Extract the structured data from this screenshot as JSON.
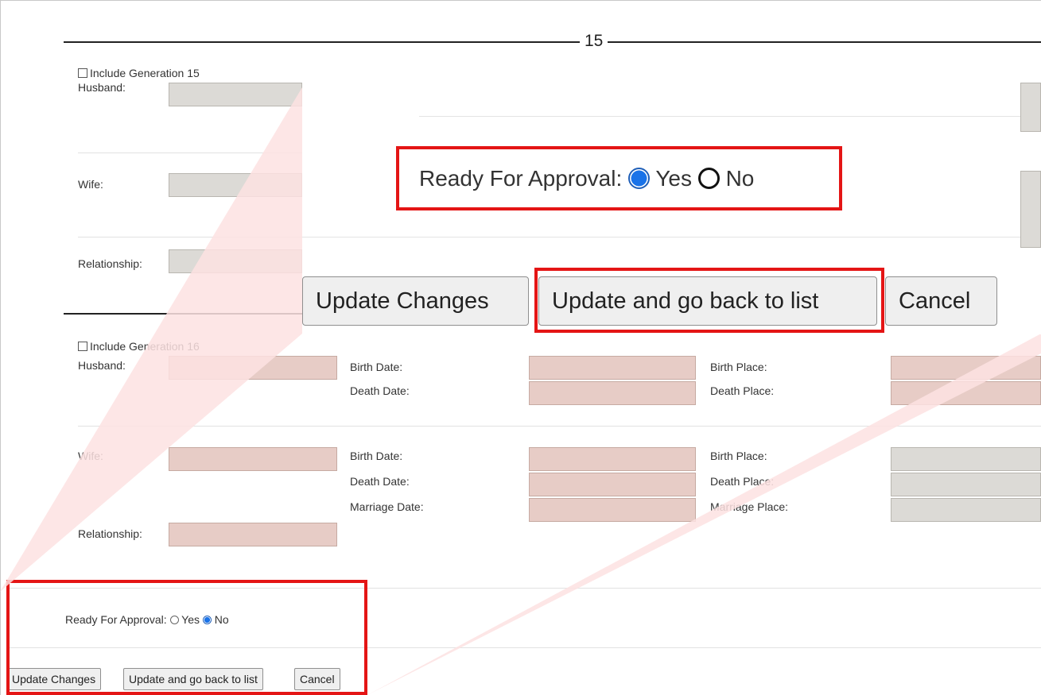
{
  "generation15": {
    "number": "15",
    "include_label": "Include Generation 15",
    "husband_label": "Husband:",
    "wife_label": "Wife:",
    "relationship_label": "Relationship:"
  },
  "generation16": {
    "include_label": "Include Generation 16",
    "husband_label": "Husband:",
    "birth_date_label": "Birth Date:",
    "death_date_label": "Death Date:",
    "birth_place_label": "Birth Place:",
    "death_place_label": "Death Place:",
    "wife_label": "Wife:",
    "wife_birth_date_label": "Birth Date:",
    "wife_death_date_label": "Death Date:",
    "marriage_date_label": "Marriage Date:",
    "wife_birth_place_label": "Birth Place:",
    "wife_death_place_label": "Death Place:",
    "marriage_place_label": "Marriage Place:",
    "relationship_label": "Relationship:"
  },
  "approval": {
    "label": "Ready For Approval:",
    "yes_label": "Yes",
    "no_label": "No",
    "selected": "No"
  },
  "zoom": {
    "approval_label": "Ready For Approval:",
    "yes_label": "Yes",
    "no_label": "No",
    "selected": "Yes",
    "update_changes_label": "Update Changes",
    "update_back_label": "Update and go back to list",
    "cancel_label": "Cancel"
  },
  "buttons": {
    "update_changes_label": "Update Changes",
    "update_back_label": "Update and go back to list",
    "cancel_label": "Cancel"
  },
  "colors": {
    "highlight_box": "#e41515",
    "zoom_wedge": "#fde2e2",
    "radio_selected": "#1a73e8"
  }
}
